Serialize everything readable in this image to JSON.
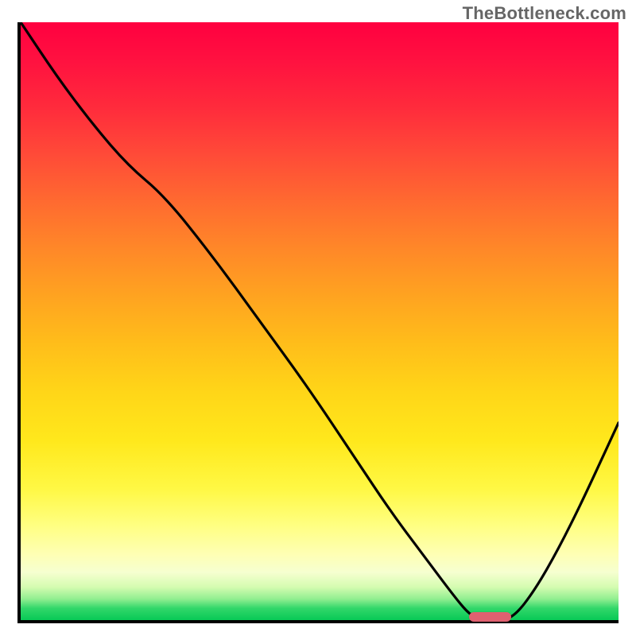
{
  "watermark": "TheBottleneck.com",
  "colors": {
    "curve": "#000000",
    "marker": "#e06070",
    "axis": "#000000"
  },
  "chart_data": {
    "type": "line",
    "title": "",
    "xlabel": "",
    "ylabel": "",
    "xlim": [
      0,
      100
    ],
    "ylim": [
      0,
      100
    ],
    "grid": false,
    "legend": null,
    "series": [
      {
        "name": "bottleneck-curve",
        "x": [
          0,
          6,
          12,
          18,
          24,
          32,
          40,
          48,
          56,
          62,
          68,
          72.5,
          75,
          77,
          80,
          82.5,
          86,
          90,
          94,
          100
        ],
        "y": [
          100,
          91,
          83,
          76,
          71,
          61,
          50,
          39,
          27,
          18,
          10,
          4,
          1,
          0,
          0,
          0.5,
          5,
          12,
          20,
          33
        ]
      }
    ],
    "annotations": [
      {
        "name": "optimal-range-marker",
        "x_start": 75,
        "x_end": 82,
        "y": 0.5
      }
    ]
  }
}
